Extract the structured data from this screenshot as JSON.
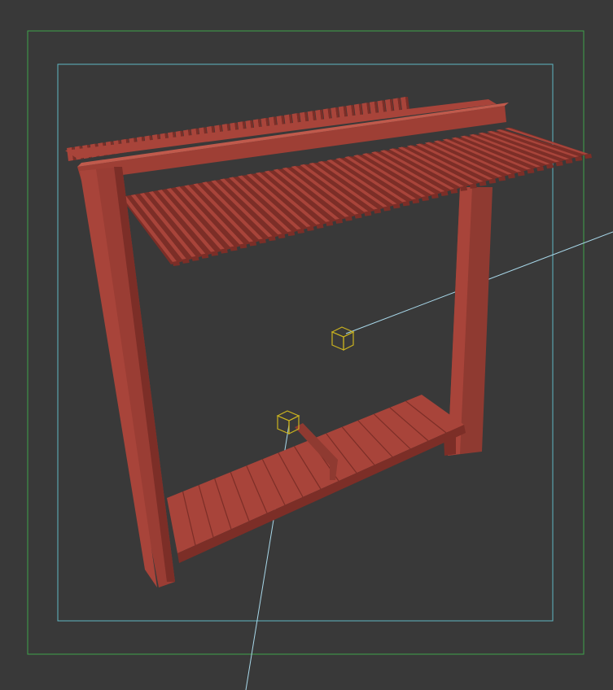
{
  "viewport": {
    "background": "#393939",
    "safe_frame_outer_color": "#3fa34a",
    "safe_frame_inner_color": "#5fb6c4",
    "model_color": "#a8443a",
    "model_shadow_color": "#7c2e27",
    "model_highlight_color": "#c05a4c",
    "gizmo_color": "#c9b21f",
    "light_line_color": "#a8d8ea",
    "slat_count_back": 44,
    "slat_count_front": 44,
    "plank_count": 16
  }
}
